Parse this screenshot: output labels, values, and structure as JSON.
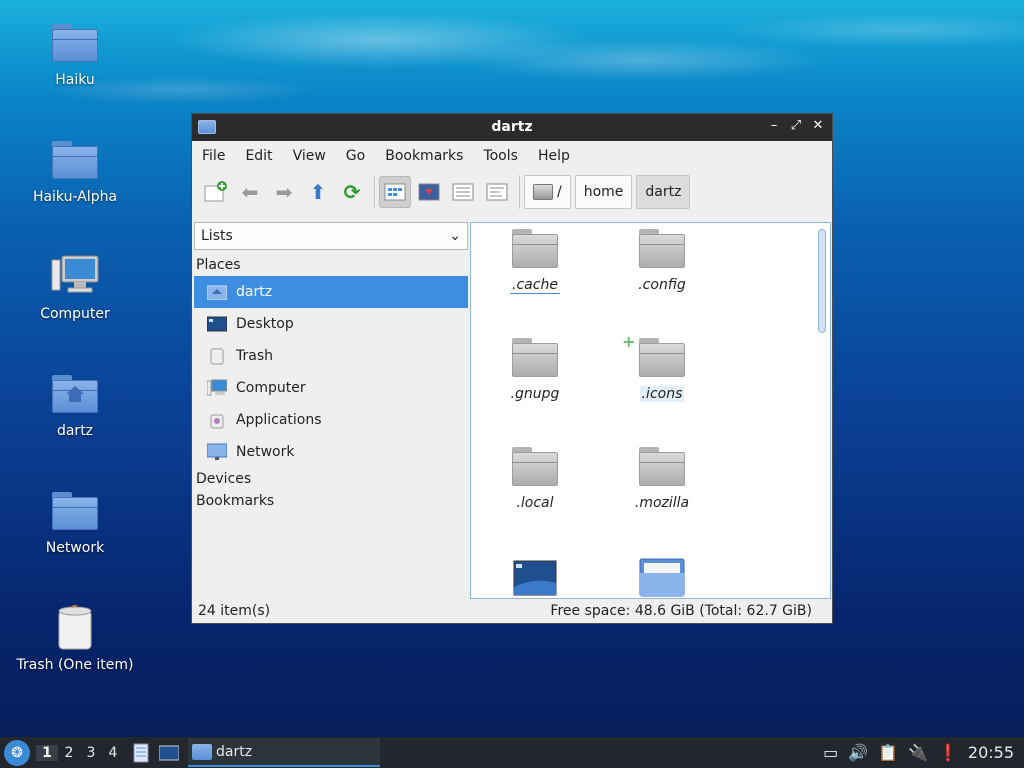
{
  "desktop": {
    "icons": [
      {
        "label": "Haiku",
        "icon": "folder-icon"
      },
      {
        "label": "Haiku-Alpha",
        "icon": "folder-icon"
      },
      {
        "label": "Computer",
        "icon": "computer-icon"
      },
      {
        "label": "dartz",
        "icon": "home-folder-icon"
      },
      {
        "label": "Network",
        "icon": "network-folder-icon"
      },
      {
        "label": "Trash (One item)",
        "icon": "trash-icon"
      }
    ]
  },
  "window": {
    "title": "dartz",
    "menu": [
      "File",
      "Edit",
      "View",
      "Go",
      "Bookmarks",
      "Tools",
      "Help"
    ],
    "breadcrumb": [
      "/",
      "home",
      "dartz"
    ],
    "side_combo": "Lists",
    "sections": {
      "places": "Places",
      "devices": "Devices",
      "bookmarks": "Bookmarks"
    },
    "places": [
      {
        "label": "dartz",
        "icon": "home-folder-icon",
        "selected": true
      },
      {
        "label": "Desktop",
        "icon": "desktop-icon"
      },
      {
        "label": "Trash",
        "icon": "trash-icon"
      },
      {
        "label": "Computer",
        "icon": "computer-icon"
      },
      {
        "label": "Applications",
        "icon": "applications-icon"
      },
      {
        "label": "Network",
        "icon": "network-icon"
      }
    ],
    "files": [
      ".cache",
      ".config",
      ".gnupg",
      ".icons",
      ".local",
      ".mozilla"
    ],
    "status_left": "24 item(s)",
    "status_right": "Free space: 48.6 GiB (Total: 62.7 GiB)"
  },
  "taskbar": {
    "workspaces": [
      "1",
      "2",
      "3",
      "4"
    ],
    "task": "dartz",
    "clock": "20:55"
  },
  "colors": {
    "accent": "#3d8ee0",
    "titlebar": "#2b2b2b",
    "taskbar": "#22272e"
  }
}
